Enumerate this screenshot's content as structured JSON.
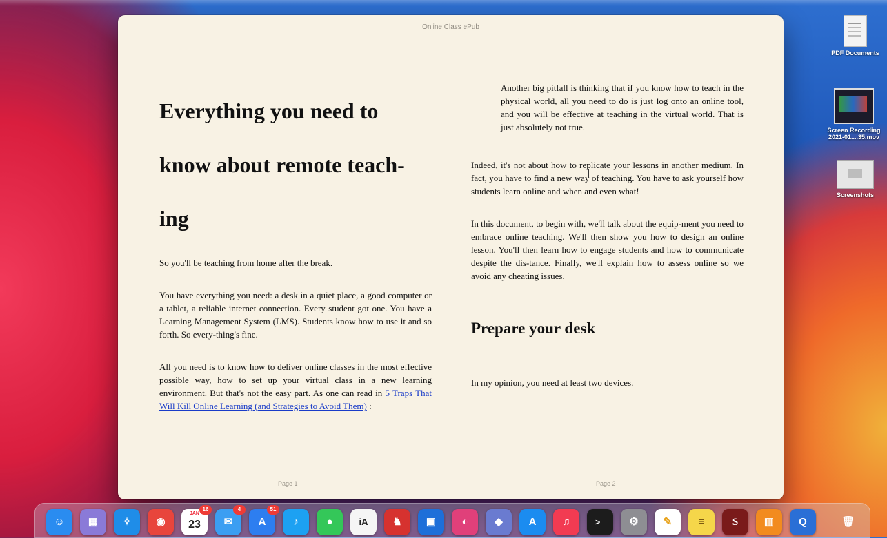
{
  "window": {
    "title": "Online Class ePub"
  },
  "page1": {
    "heading_lines": [
      "Everything you need to",
      "know about remote teach-",
      "ing"
    ],
    "paragraphs": [
      "So you'll be teaching from home after the break.",
      "You have everything you need: a desk in a quiet place, a good computer or a tablet, a reliable internet connection. Every student got one. You have a Learning Management System (LMS). Students know how to use it and so forth. So every-thing's fine.",
      "All you need is to know how to deliver online classes in the most effective possible way, how to set up your virtual class in a new learning environment. But that's not the easy part. As one can read in"
    ],
    "link_text": "5 Traps That Will Kill Online Learning (and Strategies to Avoid Them)",
    "link_suffix": " :",
    "page_label": "Page 1"
  },
  "page2": {
    "quote": "Another big pitfall is thinking that if you know how to teach in the physical world, all you need to do is just log onto an online tool, and you will be effective at teaching in the virtual world. That is just absolutely not true.",
    "paragraphs": [
      "Indeed, it's not about how to replicate your lessons in another medium. In fact, you have to find a new way of teaching. You have to ask yourself how students learn online and when and even what!",
      "In this document, to begin with, we'll talk about the equip-ment you need to embrace online teaching. We'll then show you how to design an online lesson. You'll then learn how to engage students and how to communicate despite the dis-tance. Finally, we'll explain how to assess online so we avoid any cheating issues."
    ],
    "section_heading": "Prepare your desk",
    "last_paragraph": "In my opinion, you need at least two devices.",
    "page_label": "Page 2"
  },
  "desktop": {
    "items": [
      {
        "label": "PDF Documents",
        "icon": "pdf-documents-folder-icon"
      },
      {
        "label": "Screen Recording 2021-01....35.mov",
        "icon": "video-file-icon"
      },
      {
        "label": "Screenshots",
        "icon": "screenshots-folder-icon"
      }
    ]
  },
  "dock": {
    "calendar": {
      "month": "JAN",
      "day": "23",
      "badge": "16"
    },
    "mail_badge": "4",
    "appstore_badge": "51",
    "apps": [
      {
        "name": "finder",
        "glyph": "☺",
        "color": "#2a8cf0"
      },
      {
        "name": "launchpad",
        "glyph": "▦",
        "color": "#8a7ad8"
      },
      {
        "name": "safari",
        "glyph": "✧",
        "color": "#1f8de8"
      },
      {
        "name": "chrome",
        "glyph": "◉",
        "color": "#e8453c"
      },
      {
        "name": "calendar",
        "glyph": "",
        "color": "#ffffff"
      },
      {
        "name": "mail",
        "glyph": "✉",
        "color": "#3b9ef2"
      },
      {
        "name": "app-store",
        "glyph": "A",
        "color": "#2d7ef0"
      },
      {
        "name": "twitter",
        "glyph": "♪",
        "color": "#1da1f2"
      },
      {
        "name": "messages",
        "glyph": "●",
        "color": "#34c759"
      },
      {
        "name": "ia-writer",
        "glyph": "iA",
        "color": "#f5f5f5"
      },
      {
        "name": "bear",
        "glyph": "♞",
        "color": "#d6322f"
      },
      {
        "name": "screens",
        "glyph": "▣",
        "color": "#1e6fd9"
      },
      {
        "name": "color-picker",
        "glyph": "◐",
        "color": "#e0407a"
      },
      {
        "name": "archive",
        "glyph": "◆",
        "color": "#6a7bd0"
      },
      {
        "name": "xcode",
        "glyph": "A",
        "color": "#1b8cf0"
      },
      {
        "name": "music",
        "glyph": "♫",
        "color": "#f23b52"
      },
      {
        "name": "terminal",
        "glyph": ">_",
        "color": "#1c1c1c"
      },
      {
        "name": "system-preferences",
        "glyph": "⚙",
        "color": "#8e8e93"
      },
      {
        "name": "pencil-app",
        "glyph": "✎",
        "color": "#ffffff"
      },
      {
        "name": "notes",
        "glyph": "≡",
        "color": "#f5d64a"
      },
      {
        "name": "scrivener",
        "glyph": "S",
        "color": "#7a1a1a"
      },
      {
        "name": "books",
        "glyph": "▥",
        "color": "#f28b1f"
      },
      {
        "name": "quicktime",
        "glyph": "Q",
        "color": "#2a6fd6"
      },
      {
        "name": "trash",
        "glyph": "🗑",
        "color": "#b8b8b8"
      }
    ]
  }
}
